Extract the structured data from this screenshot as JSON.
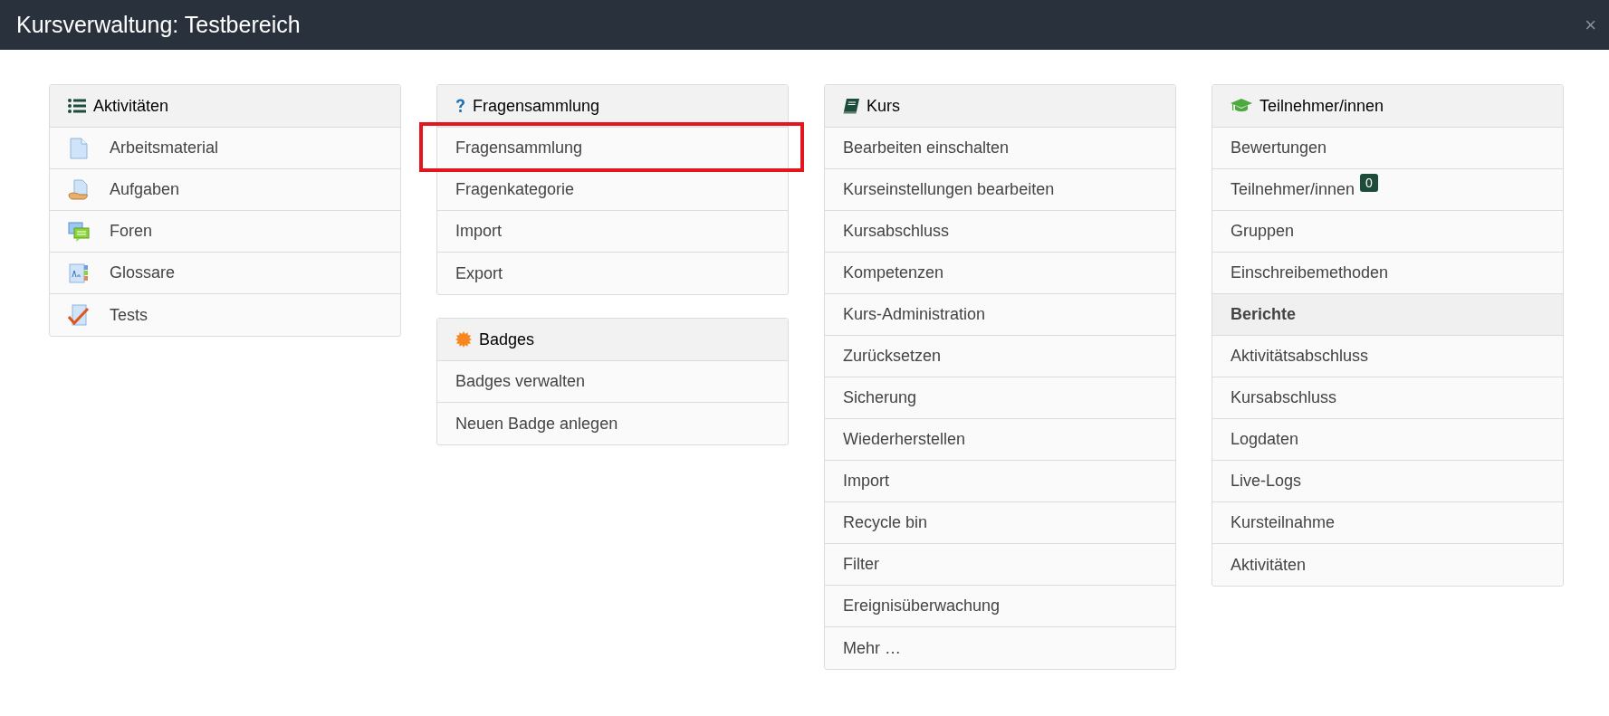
{
  "window": {
    "title": "Kursverwaltung: Testbereich",
    "close": "×"
  },
  "columns": [
    [
      {
        "title": "Aktivitäten",
        "items": [
          {
            "kind": "link",
            "label": "Arbeitsmaterial",
            "highlighted": false
          },
          {
            "kind": "link",
            "label": "Aufgaben",
            "highlighted": false
          },
          {
            "kind": "link",
            "label": "Foren",
            "highlighted": false
          },
          {
            "kind": "link",
            "label": "Glossare",
            "highlighted": false
          },
          {
            "kind": "link",
            "label": "Tests",
            "highlighted": false
          }
        ]
      }
    ],
    [
      {
        "title": "Fragensammlung",
        "items": [
          {
            "kind": "link",
            "label": "Fragensammlung",
            "highlighted": true
          },
          {
            "kind": "link",
            "label": "Fragenkategorie",
            "highlighted": false
          },
          {
            "kind": "link",
            "label": "Import",
            "highlighted": false
          },
          {
            "kind": "link",
            "label": "Export",
            "highlighted": false
          }
        ]
      },
      {
        "title": "Badges",
        "items": [
          {
            "kind": "link",
            "label": "Badges verwalten",
            "highlighted": false
          },
          {
            "kind": "link",
            "label": "Neuen Badge anlegen",
            "highlighted": false
          }
        ]
      }
    ],
    [
      {
        "title": "Kurs",
        "items": [
          {
            "kind": "link",
            "label": "Bearbeiten einschalten",
            "highlighted": false
          },
          {
            "kind": "link",
            "label": "Kurseinstellungen bearbeiten",
            "highlighted": false
          },
          {
            "kind": "link",
            "label": "Kursabschluss",
            "highlighted": false
          },
          {
            "kind": "link",
            "label": "Kompetenzen",
            "highlighted": false
          },
          {
            "kind": "link",
            "label": "Kurs-Administration",
            "highlighted": false
          },
          {
            "kind": "link",
            "label": "Zurücksetzen",
            "highlighted": false
          },
          {
            "kind": "link",
            "label": "Sicherung",
            "highlighted": false
          },
          {
            "kind": "link",
            "label": "Wiederherstellen",
            "highlighted": false
          },
          {
            "kind": "link",
            "label": "Import",
            "highlighted": false
          },
          {
            "kind": "link",
            "label": "Recycle bin",
            "highlighted": false
          },
          {
            "kind": "link",
            "label": "Filter",
            "highlighted": false
          },
          {
            "kind": "link",
            "label": "Ereignisüberwachung",
            "highlighted": false
          },
          {
            "kind": "link",
            "label": "Mehr …",
            "highlighted": false
          }
        ]
      }
    ],
    [
      {
        "title": "Teilnehmer/innen",
        "items": [
          {
            "kind": "link",
            "label": "Bewertungen",
            "highlighted": false
          },
          {
            "kind": "link",
            "label": "Teilnehmer/innen",
            "count": "0",
            "highlighted": false
          },
          {
            "kind": "link",
            "label": "Gruppen",
            "highlighted": false
          },
          {
            "kind": "link",
            "label": "Einschreibemethoden",
            "highlighted": false
          },
          {
            "kind": "subheading",
            "label": "Berichte",
            "highlighted": false
          },
          {
            "kind": "link",
            "label": "Aktivitätsabschluss",
            "highlighted": false
          },
          {
            "kind": "link",
            "label": "Kursabschluss",
            "highlighted": false
          },
          {
            "kind": "link",
            "label": "Logdaten",
            "highlighted": false
          },
          {
            "kind": "link",
            "label": "Live-Logs",
            "highlighted": false
          },
          {
            "kind": "link",
            "label": "Kursteilnahme",
            "highlighted": false
          },
          {
            "kind": "link",
            "label": "Aktivitäten",
            "highlighted": false
          }
        ]
      }
    ]
  ]
}
